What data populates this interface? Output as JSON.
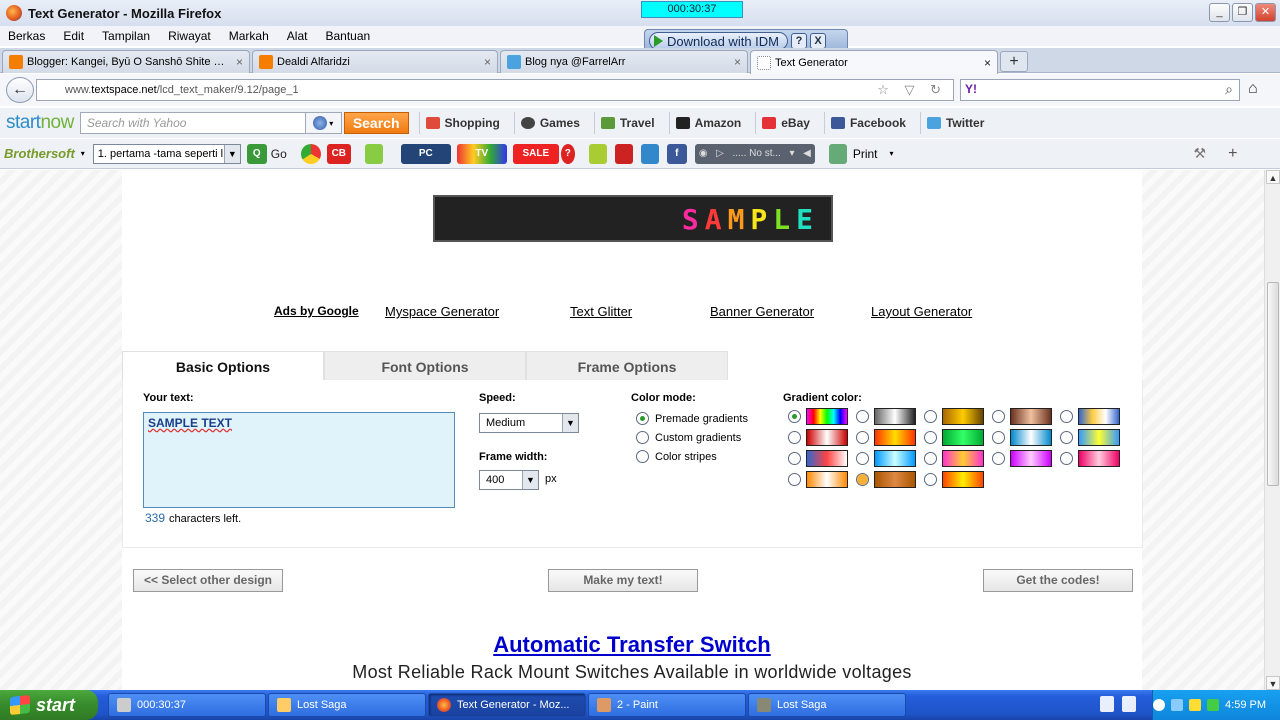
{
  "window": {
    "title": "Text Generator - Mozilla Firefox",
    "timer": "000:30:37",
    "controls": [
      "_",
      "❐",
      "✕"
    ]
  },
  "menu": [
    "Berkas",
    "Edit",
    "Tampilan",
    "Riwayat",
    "Markah",
    "Alat",
    "Bantuan"
  ],
  "idm": {
    "label": "Download with IDM",
    "help": "?",
    "close": "X"
  },
  "tabs": [
    {
      "label": "Blogger: Kangei, Byū O Sanshō Shite Kud...",
      "color": "#f57d00"
    },
    {
      "label": "Dealdi Alfaridzi",
      "color": "#f57d00"
    },
    {
      "label": "Blog nya @FarrelArr",
      "color": "#4aa3df"
    },
    {
      "label": "Text Generator",
      "color": "#ffffff"
    }
  ],
  "tab_close": "×",
  "new_tab": "+",
  "nav": {
    "back": "←",
    "url_prefix": "www.",
    "url_domain": "textspace.net",
    "url_path": "/lcd_text_maker/9.12/page_1",
    "url_icons": "☆ ▽ ↻",
    "search_brand": "Y!",
    "search_icon": "⌕",
    "home": "⌂"
  },
  "startnow": {
    "logo_a": "start",
    "logo_b": "now",
    "search_placeholder": "Search with Yahoo",
    "search_button": "Search",
    "links": [
      {
        "label": "Shopping",
        "color": "#e04a3a"
      },
      {
        "label": "Games",
        "color": "#444"
      },
      {
        "label": "Travel",
        "color": "#5a9a3a"
      },
      {
        "label": "Amazon",
        "color": "#222"
      },
      {
        "label": "eBay",
        "color": "#e53238"
      },
      {
        "label": "Facebook",
        "color": "#3b5998"
      },
      {
        "label": "Twitter",
        "color": "#4aa3df"
      }
    ]
  },
  "brothersoft": {
    "logo": "Brothersoft",
    "select_value": "1. pertama -tama seperti l",
    "go": "Go",
    "pc": "PC",
    "tv": "TV",
    "sale": "SALE",
    "player_status": "..... No st...",
    "print": "Print"
  },
  "page": {
    "sample": [
      "S",
      "A",
      "M",
      "P",
      "L",
      "E"
    ],
    "links": {
      "ads": "Ads by Google",
      "myspace": "Myspace Generator",
      "glitter": "Text Glitter",
      "banner": "Banner Generator",
      "layout": "Layout Generator"
    },
    "option_tabs": [
      "Basic Options",
      "Font Options",
      "Frame Options"
    ],
    "your_text_label": "Your text:",
    "your_text_value": "SAMPLE TEXT",
    "chars_left_count": "339",
    "chars_left_label": "characters left.",
    "speed_label": "Speed:",
    "speed_value": "Medium",
    "frame_width_label": "Frame width:",
    "frame_width_value": "400",
    "frame_width_unit": "px",
    "color_mode_label": "Color mode:",
    "color_modes": [
      "Premade gradients",
      "Custom gradients",
      "Color stripes"
    ],
    "gradient_label": "Gradient color:",
    "buttons": {
      "select_other": "<< Select other design",
      "make": "Make my text!",
      "codes": "Get the codes!"
    },
    "ad_title": "Automatic Transfer Switch",
    "ad_desc": "Most Reliable Rack Mount Switches Available in worldwide voltages"
  },
  "taskbar": {
    "start": "start",
    "items": [
      {
        "label": "000:30:37"
      },
      {
        "label": "Lost Saga"
      },
      {
        "label": "Text Generator - Moz..."
      },
      {
        "label": "2 - Paint"
      },
      {
        "label": "Lost Saga"
      }
    ],
    "clock": "4:59 PM"
  }
}
